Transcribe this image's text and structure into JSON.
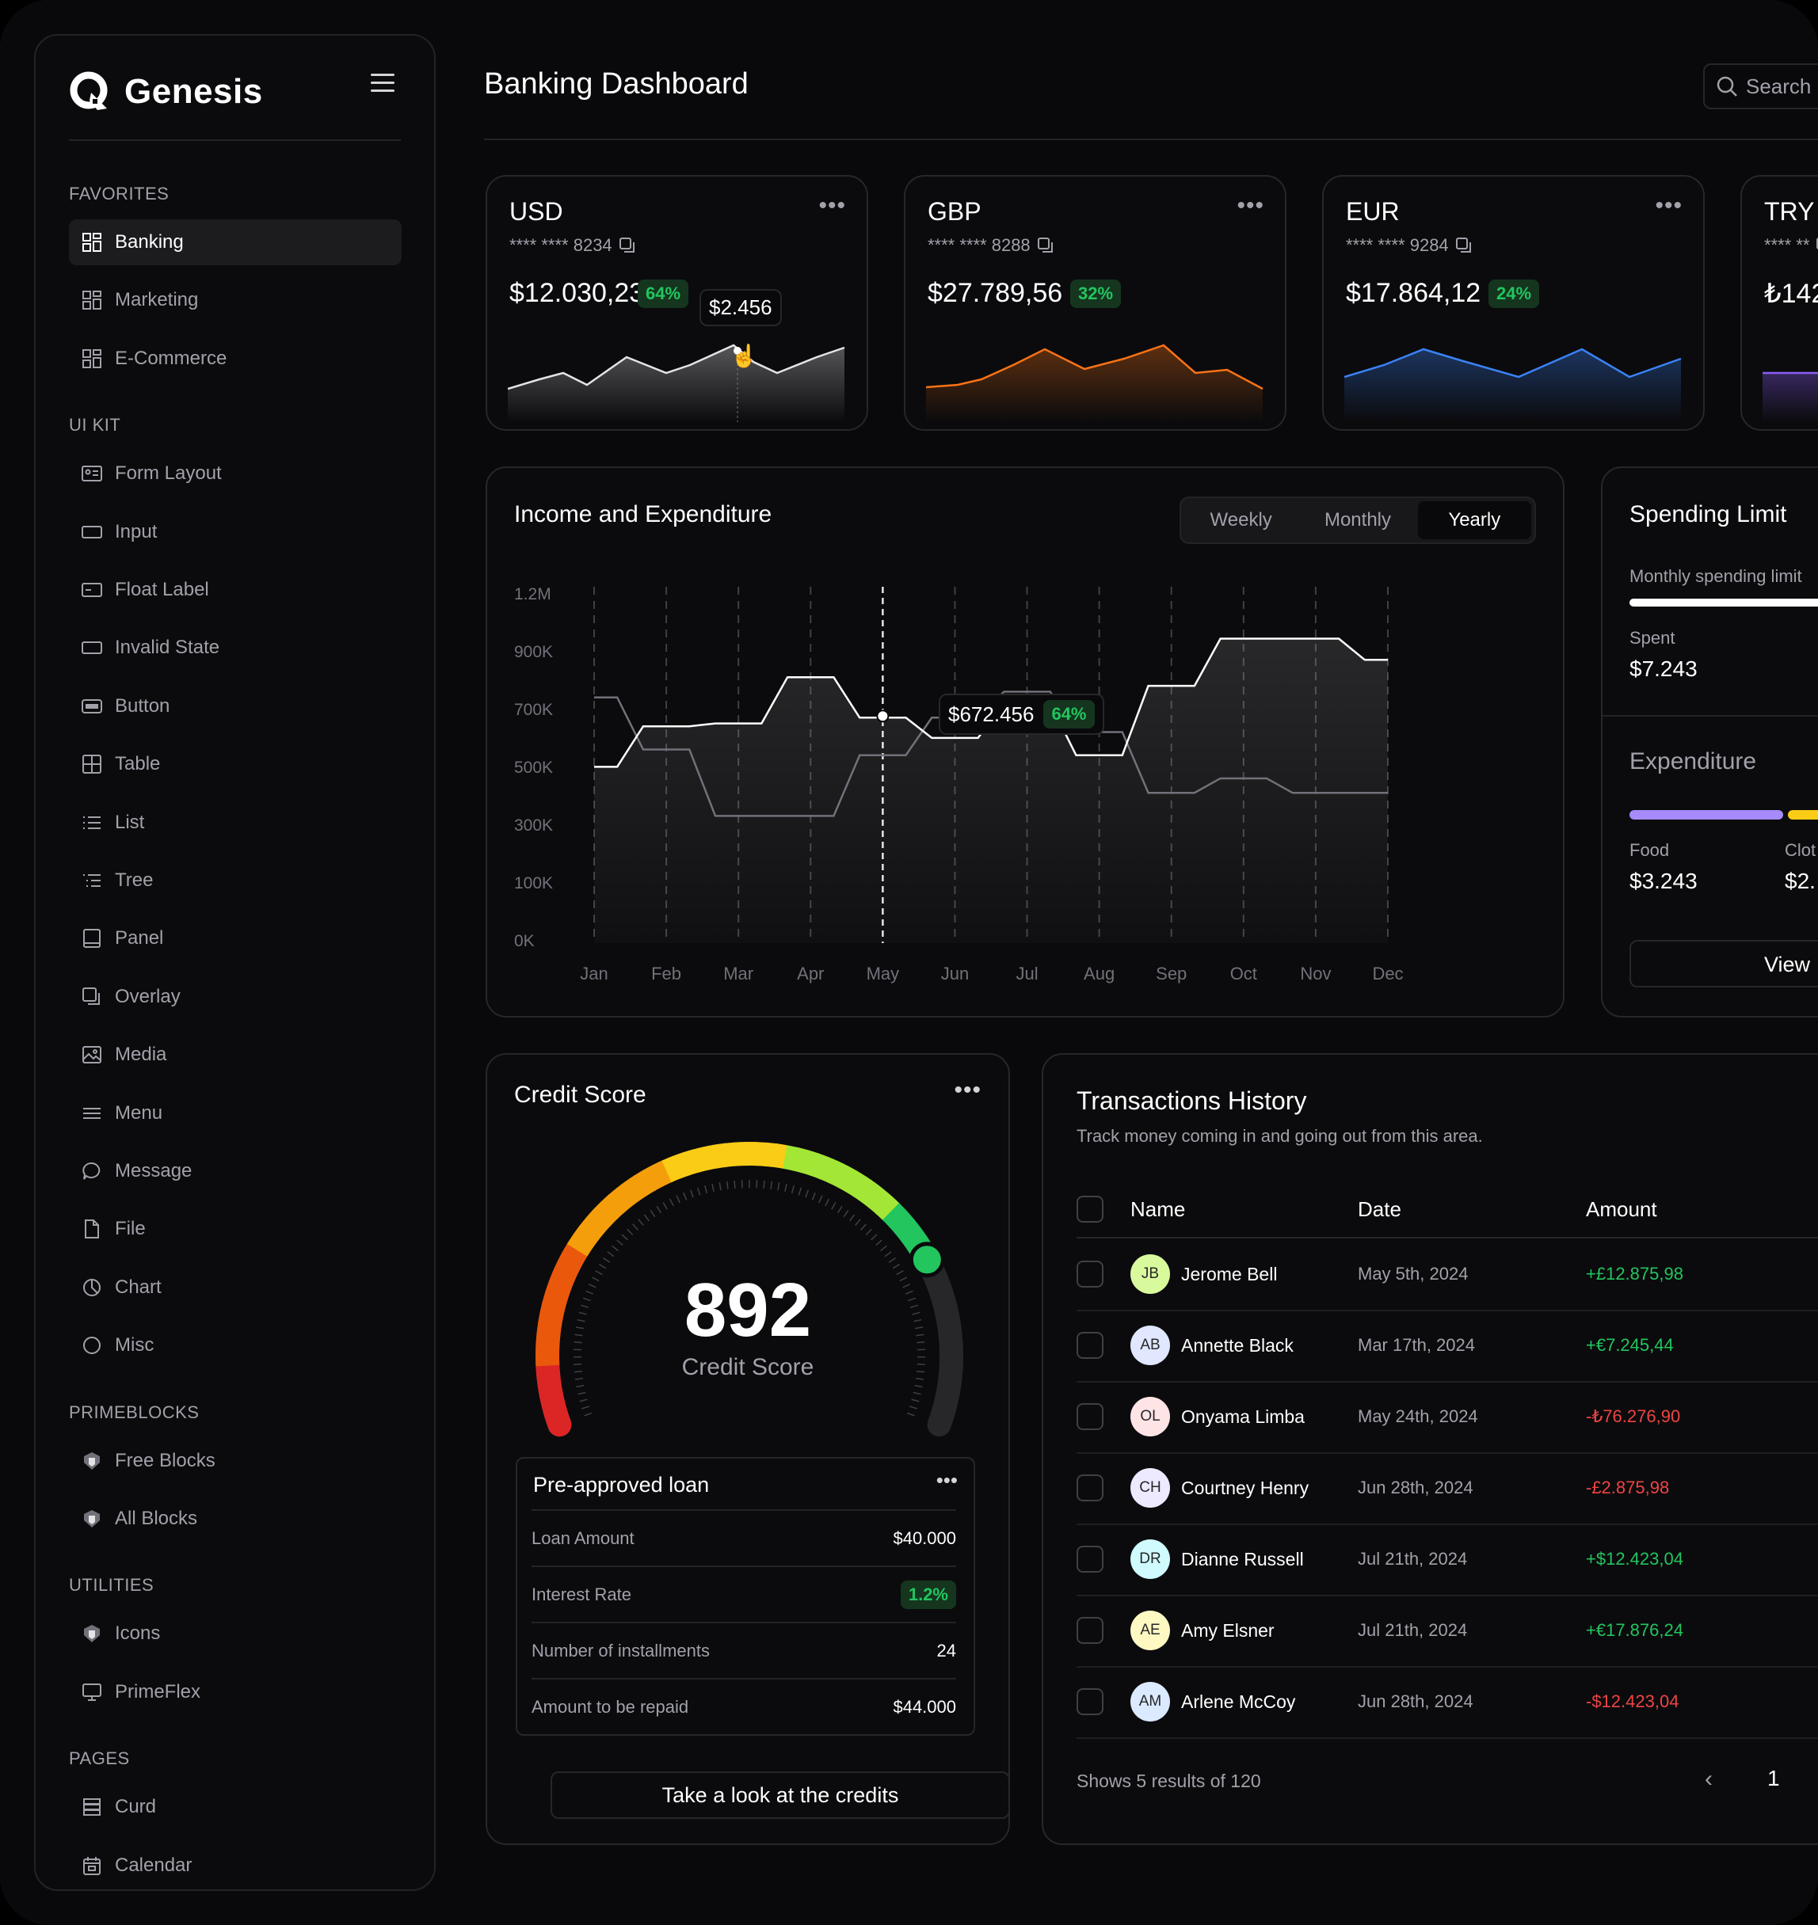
{
  "app": {
    "name": "Genesis",
    "page_title": "Banking Dashboard",
    "search_placeholder": "Search"
  },
  "sidebar": {
    "sections": [
      {
        "title": "FAVORITES",
        "items": [
          {
            "label": "Banking",
            "icon": "dashboard-icon",
            "active": true
          },
          {
            "label": "Marketing",
            "icon": "dashboard-icon"
          },
          {
            "label": "E-Commerce",
            "icon": "dashboard-icon"
          }
        ]
      },
      {
        "title": "UI KIT",
        "items": [
          {
            "label": "Form Layout",
            "icon": "form-icon"
          },
          {
            "label": "Input",
            "icon": "input-icon"
          },
          {
            "label": "Float Label",
            "icon": "float-label-icon"
          },
          {
            "label": "Invalid State",
            "icon": "input-icon"
          },
          {
            "label": "Button",
            "icon": "button-icon"
          },
          {
            "label": "Table",
            "icon": "table-icon"
          },
          {
            "label": "List",
            "icon": "list-icon"
          },
          {
            "label": "Tree",
            "icon": "tree-icon"
          },
          {
            "label": "Panel",
            "icon": "panel-icon"
          },
          {
            "label": "Overlay",
            "icon": "overlay-icon"
          },
          {
            "label": "Media",
            "icon": "image-icon"
          },
          {
            "label": "Menu",
            "icon": "menu-icon"
          },
          {
            "label": "Message",
            "icon": "message-icon"
          },
          {
            "label": "File",
            "icon": "file-icon"
          },
          {
            "label": "Chart",
            "icon": "chart-icon"
          },
          {
            "label": "Misc",
            "icon": "circle-icon"
          }
        ]
      },
      {
        "title": "PRIMEBLOCKS",
        "items": [
          {
            "label": "Free Blocks",
            "icon": "prime-icon"
          },
          {
            "label": "All Blocks",
            "icon": "prime-icon"
          }
        ]
      },
      {
        "title": "UTILITIES",
        "items": [
          {
            "label": "Icons",
            "icon": "prime-icon"
          },
          {
            "label": "PrimeFlex",
            "icon": "desktop-icon"
          }
        ]
      },
      {
        "title": "PAGES",
        "items": [
          {
            "label": "Curd",
            "icon": "database-icon"
          },
          {
            "label": "Calendar",
            "icon": "calendar-icon"
          }
        ]
      }
    ]
  },
  "cards": [
    {
      "currency": "USD",
      "number": "**** **** 8234",
      "balance": "$12.030,23",
      "change": "64%",
      "color": "#e4e4e7",
      "tooltip": "$2.456"
    },
    {
      "currency": "GBP",
      "number": "**** **** 8288",
      "balance": "$27.789,56",
      "change": "32%",
      "color": "#f97316"
    },
    {
      "currency": "EUR",
      "number": "**** **** 9284",
      "balance": "$17.864,12",
      "change": "24%",
      "color": "#3b82f6"
    },
    {
      "currency": "TRY",
      "number": "**** **",
      "balance": "₺142",
      "color": "#8b5cf6"
    }
  ],
  "income": {
    "title": "Income and Expenditure",
    "tabs": [
      "Weekly",
      "Monthly",
      "Yearly"
    ],
    "active_tab": "Yearly",
    "tooltip_value": "$672.456",
    "tooltip_change": "64%"
  },
  "chart_data": {
    "type": "area",
    "title": "Income and Expenditure",
    "categories": [
      "Jan",
      "Feb",
      "Mar",
      "Apr",
      "May",
      "Jun",
      "Jul",
      "Aug",
      "Sep",
      "Oct",
      "Nov",
      "Dec"
    ],
    "y_ticks": [
      "1.2M",
      "900K",
      "700K",
      "500K",
      "300K",
      "100K",
      "0K"
    ],
    "series": [
      {
        "values": [
          510000,
          650000,
          660000,
          820000,
          680000,
          610000,
          730000,
          550000,
          790000,
          980000,
          980000,
          880000
        ]
      },
      {
        "values": [
          750000,
          570000,
          340000,
          340000,
          550000,
          680000,
          770000,
          630000,
          420000,
          470000,
          420000,
          420000
        ]
      }
    ],
    "highlight": {
      "category": "May",
      "value": "$672.456",
      "change": "64%"
    }
  },
  "spending": {
    "title": "Spending Limit",
    "limit_label": "Monthly spending limit",
    "spent_label": "Spent",
    "spent_value": "$7.243",
    "expenditure_title": "Expenditure",
    "items": [
      {
        "label": "Food",
        "value": "$3.243",
        "color": "#a78bfa"
      },
      {
        "label": "Clot",
        "value": "$2.",
        "color": "#facc15"
      }
    ],
    "view_label": "View"
  },
  "credit": {
    "title": "Credit Score",
    "score": "892",
    "score_label": "Credit Score",
    "score_fraction": 0.78,
    "loan": {
      "title": "Pre-approved loan",
      "rows": [
        {
          "key": "Loan Amount",
          "value": "$40.000"
        },
        {
          "key": "Interest Rate",
          "value": "1.2%",
          "badge": true
        },
        {
          "key": "Number of installments",
          "value": "24"
        },
        {
          "key": "Amount to be repaid",
          "value": "$44.000"
        }
      ]
    },
    "button": "Take a look at the credits"
  },
  "transactions": {
    "title": "Transactions History",
    "subtitle": "Track money coming in and going out from this area.",
    "columns": [
      "Name",
      "Date",
      "Amount"
    ],
    "rows": [
      {
        "initials": "JB",
        "name": "Jerome Bell",
        "date": "May 5th, 2024",
        "amount": "+£12.875,98",
        "positive": true,
        "avatar": "#d9f99d"
      },
      {
        "initials": "AB",
        "name": "Annette Black",
        "date": "Mar 17th, 2024",
        "amount": "+€7.245,44",
        "positive": true,
        "avatar": "#e0e7ff"
      },
      {
        "initials": "OL",
        "name": "Onyama Limba",
        "date": "May 24th, 2024",
        "amount": "-₺76.276,90",
        "positive": false,
        "avatar": "#ffe4e6"
      },
      {
        "initials": "CH",
        "name": "Courtney Henry",
        "date": "Jun 28th, 2024",
        "amount": "-£2.875,98",
        "positive": false,
        "avatar": "#ede9fe"
      },
      {
        "initials": "DR",
        "name": "Dianne Russell",
        "date": "Jul 21th, 2024",
        "amount": "+$12.423,04",
        "positive": true,
        "avatar": "#cffafe"
      },
      {
        "initials": "AE",
        "name": "Amy Elsner",
        "date": "Jul 21th, 2024",
        "amount": "+€17.876,24",
        "positive": true,
        "avatar": "#fef9c3"
      },
      {
        "initials": "AM",
        "name": "Arlene McCoy",
        "date": "Jun 28th, 2024",
        "amount": "-$12.423,04",
        "positive": false,
        "avatar": "#dbeafe"
      }
    ],
    "footer": "Shows 5 results of 120",
    "page": "1"
  }
}
